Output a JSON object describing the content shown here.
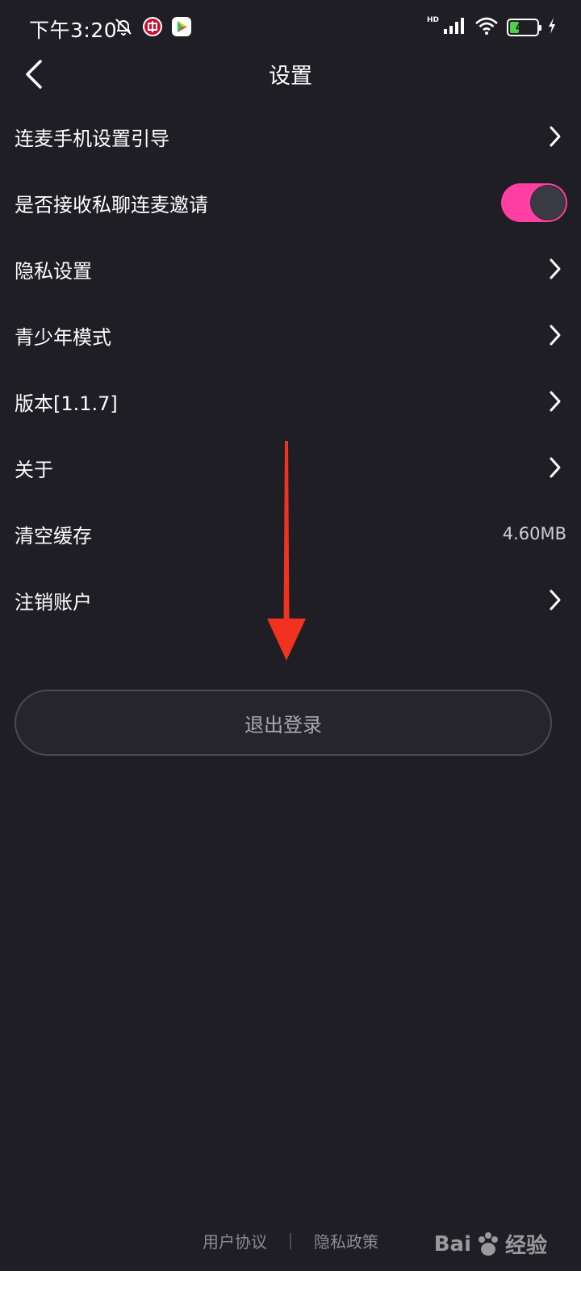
{
  "status_bar": {
    "time": "下午3:20",
    "network_label": "HD",
    "battery_level": "42",
    "battery_fraction": 0.42
  },
  "nav": {
    "title": "设置"
  },
  "settings": {
    "items": [
      {
        "label": "连麦手机设置引导",
        "accessory": "chevron"
      },
      {
        "label": "是否接收私聊连麦邀请",
        "accessory": "toggle",
        "toggle_on": true
      },
      {
        "label": "隐私设置",
        "accessory": "chevron"
      },
      {
        "label": "青少年模式",
        "accessory": "chevron"
      },
      {
        "label": "版本[1.1.7]",
        "accessory": "chevron"
      },
      {
        "label": "关于",
        "accessory": "chevron"
      },
      {
        "label": "清空缓存",
        "accessory": "value",
        "value": "4.60MB"
      },
      {
        "label": "注销账户",
        "accessory": "chevron"
      }
    ]
  },
  "logout": {
    "label": "退出登录"
  },
  "footer": {
    "user_agreement": "用户协议",
    "privacy_policy": "隐私政策"
  },
  "watermark": {
    "text_left": "Bai",
    "text_right": "经验"
  },
  "colors": {
    "background": "#1f1e24",
    "accent": "#ff3fa3",
    "annotation": "#f0321e",
    "battery": "#4fd04f"
  }
}
